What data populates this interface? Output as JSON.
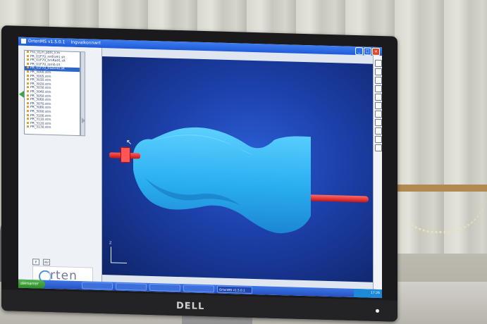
{
  "window": {
    "app_title": "OrtenMS v1.5.0.1",
    "document_title": "Ingvalkonnwrt"
  },
  "left_pane": {
    "tree_items": [
      {
        "label": "Pro_01/ri_pbts_lcm",
        "selected": false
      },
      {
        "label": "PR_01F70_nHfra91.slt",
        "selected": false
      },
      {
        "label": "PR_01F70_hmRa91.slt",
        "selected": false
      },
      {
        "label": "PR_01F70_lomb.slt",
        "selected": false
      },
      {
        "label": "PR_01F70_tfadV40.slt",
        "selected": true
      },
      {
        "label": "PR_3000.stm",
        "selected": false
      },
      {
        "label": "PR_3005.stm",
        "selected": false
      },
      {
        "label": "PR_3010.stm",
        "selected": false
      },
      {
        "label": "PR_3020.stm",
        "selected": false
      },
      {
        "label": "PR_3030.stm",
        "selected": false
      },
      {
        "label": "PR_3040.stm",
        "selected": false
      },
      {
        "label": "PR_3050.stm",
        "selected": false
      },
      {
        "label": "PR_3060.stm",
        "selected": false
      },
      {
        "label": "PR_3070.stm",
        "selected": false
      },
      {
        "label": "PR_3080.stm",
        "selected": false
      },
      {
        "label": "PR_3090.stm",
        "selected": false
      },
      {
        "label": "PR_3100.stm",
        "selected": false
      },
      {
        "label": "PR_3110.stm",
        "selected": false
      },
      {
        "label": "PR_3120.stm",
        "selected": false
      },
      {
        "label": "PR_3130.stm",
        "selected": false
      }
    ],
    "mini_buttons": [
      "P",
      "NV"
    ],
    "logo_text": "rten"
  },
  "viewport": {
    "axes_label": "Z"
  },
  "taskbar": {
    "start_label": "démarrer",
    "tasks": [
      {
        "label": "",
        "active": false
      },
      {
        "label": "",
        "active": false
      },
      {
        "label": "",
        "active": false
      },
      {
        "label": "",
        "active": false
      },
      {
        "label": "OrtenMS v1.5.0.1",
        "active": true
      }
    ],
    "tray_time": "17:26"
  },
  "monitor": {
    "brand": "DELL"
  },
  "colors": {
    "viewport_blue": "#1c3fa8",
    "model_cyan": "#2fb2f0",
    "rod_red": "#e02020",
    "title_blue": "#1f5ad8",
    "start_green": "#2d8c2a"
  }
}
